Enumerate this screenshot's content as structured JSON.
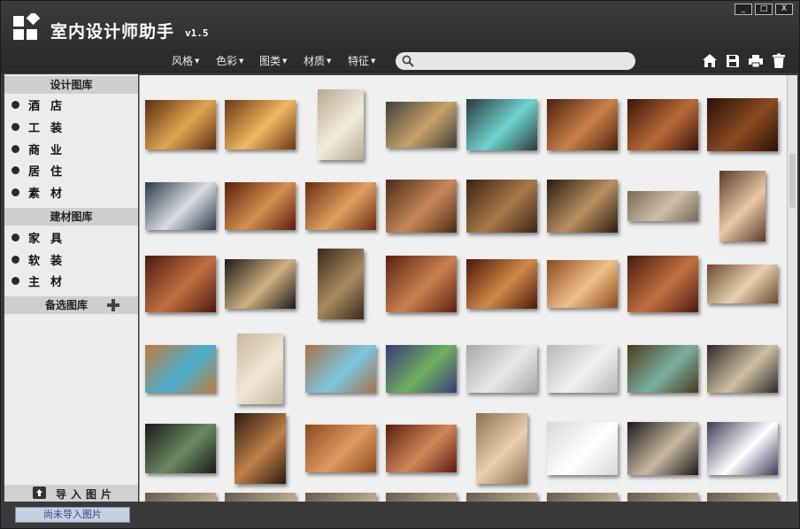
{
  "app": {
    "title": "室内设计师助手",
    "version": "v1.5",
    "window_controls": [
      "_",
      "□",
      "X"
    ]
  },
  "toolbar": {
    "menus": [
      {
        "label": "风格"
      },
      {
        "label": "色彩"
      },
      {
        "label": "图类"
      },
      {
        "label": "材质"
      },
      {
        "label": "特征"
      }
    ],
    "caret": "▼",
    "search": {
      "value": "",
      "placeholder": ""
    },
    "icons": [
      "home-icon",
      "save-icon",
      "print-icon",
      "trash-icon"
    ]
  },
  "sidebar": {
    "design_library": {
      "title": "设计图库",
      "items": [
        {
          "label": "酒店"
        },
        {
          "label": "工装"
        },
        {
          "label": "商业"
        },
        {
          "label": "居住"
        },
        {
          "label": "素材"
        }
      ]
    },
    "material_library": {
      "title": "建材图库",
      "items": [
        {
          "label": "家具"
        },
        {
          "label": "软装"
        },
        {
          "label": "主材"
        }
      ]
    },
    "backup_library": {
      "title": "备选图库"
    },
    "import_label": "导入图片"
  },
  "status": {
    "text": "尚未导入图片"
  },
  "colors": {
    "chrome_dark": "#2e2e2e",
    "sidebar_bg": "#ececec",
    "sidebar_header": "#cfcfcf",
    "gallery_bg": "#f0f0f0",
    "status_field": "#c5d1e2"
  },
  "gallery": {
    "rows": [
      [
        {
          "c1": "#5a2d12",
          "c2": "#e0a550"
        },
        {
          "c1": "#6a3515",
          "c2": "#f0b860"
        },
        {
          "c1": "#b8a890",
          "c2": "#f2ecde"
        },
        {
          "c1": "#3e3f3a",
          "c2": "#c9a16a"
        },
        {
          "c1": "#2a3a3c",
          "c2": "#6fd3d0"
        },
        {
          "c1": "#4a200c",
          "c2": "#c98048"
        },
        {
          "c1": "#3a1408",
          "c2": "#b86a38"
        },
        {
          "c1": "#2a1006",
          "c2": "#8a4a22"
        }
      ],
      [
        {
          "c1": "#2b3a4a",
          "c2": "#d8dde2"
        },
        {
          "c1": "#5a1c0c",
          "c2": "#d49050"
        },
        {
          "c1": "#6a2a10",
          "c2": "#e0a060"
        },
        {
          "c1": "#4a2a18",
          "c2": "#c88858"
        },
        {
          "c1": "#3a2412",
          "c2": "#a8784a"
        },
        {
          "c1": "#2a1c12",
          "c2": "#b89060"
        },
        {
          "c1": "#7a6a56",
          "c2": "#cdbfa8"
        },
        {
          "c1": "#5a3a28",
          "c2": "#e8c8a8"
        }
      ],
      [
        {
          "c1": "#4a1a10",
          "c2": "#c07040"
        },
        {
          "c1": "#1a1a1a",
          "c2": "#d0b080"
        },
        {
          "c1": "#3a2a1a",
          "c2": "#a88a60"
        },
        {
          "c1": "#5a2010",
          "c2": "#c88050"
        },
        {
          "c1": "#4a1808",
          "c2": "#d08848"
        },
        {
          "c1": "#8a4a20",
          "c2": "#f0c088"
        },
        {
          "c1": "#4a1a10",
          "c2": "#c07040"
        },
        {
          "c1": "#6a4a30",
          "c2": "#e8d0b0"
        }
      ],
      [
        {
          "c1": "#c07a3a",
          "c2": "#4ab0d0"
        },
        {
          "c1": "#c8b8a0",
          "c2": "#f0e6d6"
        },
        {
          "c1": "#a87048",
          "c2": "#7ac8e0"
        },
        {
          "c1": "#3a3a7a",
          "c2": "#70b060"
        },
        {
          "c1": "#a8a8a8",
          "c2": "#e8e8e8"
        },
        {
          "c1": "#b8b8b8",
          "c2": "#f0f0f0"
        },
        {
          "c1": "#4a3a1a",
          "c2": "#7ab0a0"
        },
        {
          "c1": "#2a2a2a",
          "c2": "#d0c0a0"
        }
      ],
      [
        {
          "c1": "#1a1a1a",
          "c2": "#6a8a60"
        },
        {
          "c1": "#2a1a10",
          "c2": "#c08048"
        },
        {
          "c1": "#8a4a20",
          "c2": "#e09860"
        },
        {
          "c1": "#5a1c10",
          "c2": "#d08858"
        },
        {
          "c1": "#8a7050",
          "c2": "#e8d0b0"
        },
        {
          "c1": "#d8d8d8",
          "c2": "#ffffff"
        },
        {
          "c1": "#1a1a1a",
          "c2": "#c8b8a0"
        },
        {
          "c1": "#3a3a5a",
          "c2": "#ffffff"
        }
      ]
    ]
  }
}
